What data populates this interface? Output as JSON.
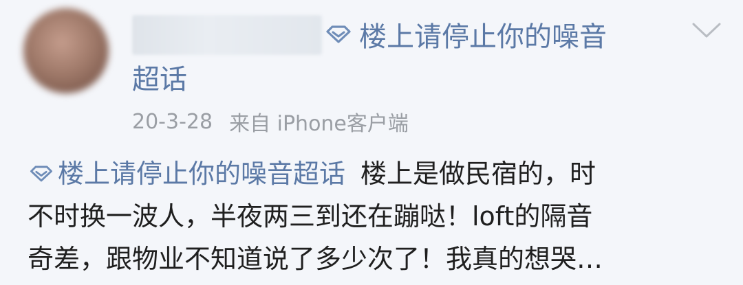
{
  "post": {
    "supertopic_line1": "楼上请停止你的噪音",
    "supertopic_line2": "超话",
    "timestamp": "20-3-28",
    "source": "来自 iPhone客户端",
    "content": {
      "topic_link": "楼上请停止你的噪音超话",
      "line1_rest": "楼上是做民宿的，时",
      "line2": "不时换一波人，半夜两三到还在蹦哒！loft的隔音",
      "line3": "奇差，跟物业不知道说了多少次了！我真的想哭…"
    }
  },
  "icons": {
    "supertopic": "diamond-icon",
    "expand": "chevron-down-icon"
  },
  "colors": {
    "link": "#5b79a6",
    "meta": "#9a9ea4",
    "text": "#1f1f1f",
    "background": "#f4f6fa"
  }
}
